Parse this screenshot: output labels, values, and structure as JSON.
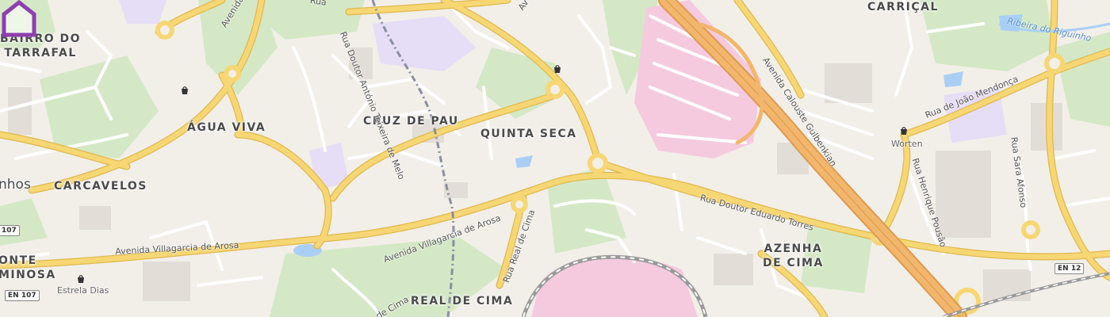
{
  "map": {
    "districts": {
      "bairro_do_tarrafal_line1": "BAIRRO DO",
      "bairro_do_tarrafal_line2": "TARRAFAL",
      "agua_viva": "ÁGUA VIVA",
      "cruz_de_pau": "CRUZ DE PAU",
      "quinta_seca": "QUINTA SECA",
      "carcavelos": "CARCAVELOS",
      "carrical": "CARRIÇAL",
      "azenha_line1": "AZENHA",
      "azenha_line2": "DE CIMA",
      "real_de_cima": "REAL DE CIMA",
      "monte_line1": "ONTE",
      "monte_line2": "MINOSA",
      "edge_partial": "nhos"
    },
    "streets": {
      "avenida_villagarcia_west": "Avenida Villagarcia de Arosa",
      "avenida_villagarcia_east": "Avenida Villagarcia de Arosa",
      "rua_antonio_teixeira": "Rua Doutor António Teixeira de Melo",
      "rua_eduardo_torres": "Rua Doutor Eduardo Torres",
      "avenida_calouste": "Avenida Calouste Gulbenkian",
      "rua_joao_mendonca": "Rua de João Mendonça",
      "rua_sara_afonso": "Rua Sara Afonso",
      "rua_henrique_pousao": "Rua Henrique Pousão",
      "rua_real_de_cima": "Rua Real de Cima",
      "rua_top": "Rua",
      "avenida_top": "Avenida",
      "avenida_top_right": "Av",
      "de_cima": "de Cima"
    },
    "river": "Ribeira do Riguinho",
    "pois": {
      "worten": "Worten",
      "estrela_dias": "Estrela Dias"
    },
    "road_shields": {
      "en107_top": "107",
      "en107_bottom": "EN 107",
      "en12": "EN 12"
    },
    "icons": [
      "shopping-bag-icon",
      "home-marker-icon"
    ],
    "colors": {
      "background": "#f2efe9",
      "major_road": "#f7d774",
      "motorway": "#f2b66c",
      "park": "#cfe6c0",
      "hospital": "#f4c6dc",
      "school": "#e4dcf5",
      "water": "#a9cff5",
      "marker": "#8e3fb0"
    }
  }
}
